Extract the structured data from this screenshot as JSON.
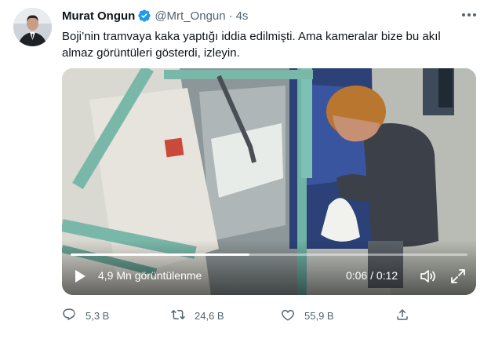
{
  "author": {
    "name": "Murat Ongun",
    "handle": "@Mrt_Ongun",
    "separator": "·",
    "time": "4s",
    "verified": true
  },
  "tweet": {
    "text": "Boji’nin tramvaya kaka yaptığı iddia edilmişti. Ama kameralar bize bu akıl\nalmaz görüntüleri gösterdi, izleyin."
  },
  "video": {
    "views": "4,9 Mn görüntülenme",
    "timecode": "0:06 / 0:12",
    "progress": 0.45
  },
  "actions": {
    "replies": "5,3 B",
    "retweets": "24,6 B",
    "likes": "55,9 B"
  },
  "colors": {
    "verified": "#1d9bf0",
    "muted": "#536471",
    "text": "#0f1419"
  },
  "icons": {
    "more": "more-icon",
    "verified": "verified-badge-icon",
    "play": "play-icon",
    "volume": "volume-icon",
    "fullscreen": "fullscreen-icon",
    "reply": "reply-icon",
    "retweet": "retweet-icon",
    "like": "like-icon",
    "share": "share-icon"
  }
}
